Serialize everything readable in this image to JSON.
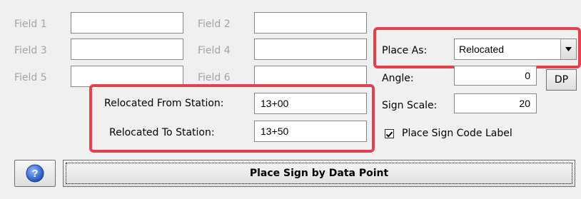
{
  "fields": [
    {
      "label": "Field 1",
      "value": ""
    },
    {
      "label": "Field 2",
      "value": ""
    },
    {
      "label": "Field 3",
      "value": ""
    },
    {
      "label": "Field 4",
      "value": ""
    },
    {
      "label": "Field 5",
      "value": ""
    },
    {
      "label": "Field 6",
      "value": ""
    }
  ],
  "relocated": {
    "from_label": "Relocated From Station:",
    "from_value": "13+00",
    "to_label": "Relocated To Station:",
    "to_value": "13+50"
  },
  "place_as": {
    "label": "Place As:",
    "value": "Relocated"
  },
  "angle": {
    "label": "Angle:",
    "value": "0"
  },
  "dp_button": "DP",
  "sign_scale": {
    "label": "Sign Scale:",
    "value": "20"
  },
  "place_code_label": {
    "label": "Place Sign Code Label",
    "checked": true
  },
  "main_button": "Place Sign by Data Point",
  "colors": {
    "highlight": "#e0424e",
    "help_icon": "#2a62c9"
  },
  "icons": {
    "help": "help-icon",
    "checkbox": "checkmark-icon",
    "dropdown": "chevron-down-icon"
  }
}
